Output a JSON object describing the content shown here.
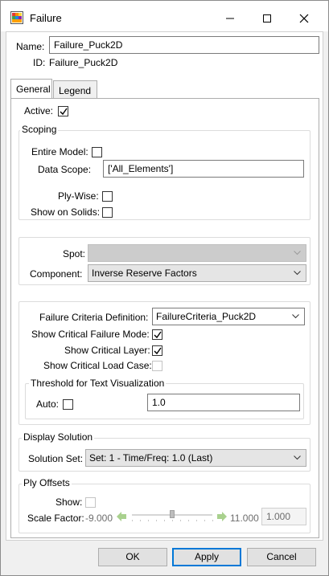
{
  "window": {
    "title": "Failure",
    "icon": "failure-app-icon",
    "minimize_icon": "minimize-icon",
    "maximize_icon": "maximize-icon",
    "close_icon": "close-icon"
  },
  "header": {
    "name_label": "Name:",
    "name_value": "Failure_Puck2D",
    "id_label": "ID:",
    "id_value": "Failure_Puck2D"
  },
  "tabs": [
    {
      "label": "General",
      "active": true
    },
    {
      "label": "Legend",
      "active": false
    }
  ],
  "general": {
    "active_label": "Active:",
    "active_checked": true,
    "scoping": {
      "title": "Scoping",
      "entire_model_label": "Entire Model:",
      "entire_model_checked": false,
      "data_scope_label": "Data Scope:",
      "data_scope_value": "['All_Elements']",
      "ply_wise_label": "Ply-Wise:",
      "ply_wise_checked": false,
      "show_on_solids_label": "Show on Solids:",
      "show_on_solids_checked": false
    },
    "spot_label": "Spot:",
    "spot_value": "",
    "component_label": "Component:",
    "component_value": "Inverse Reserve Factors",
    "failure_criteria_label": "Failure Criteria Definition:",
    "failure_criteria_value": "FailureCriteria_Puck2D",
    "show_critical_failure_mode_label": "Show Critical Failure Mode:",
    "show_critical_failure_mode_checked": true,
    "show_critical_layer_label": "Show Critical Layer:",
    "show_critical_layer_checked": true,
    "show_critical_load_case_label": "Show Critical Load Case:",
    "show_critical_load_case_checked": false,
    "threshold": {
      "title": "Threshold for Text Visualization",
      "auto_label": "Auto:",
      "auto_checked": false,
      "value": "1.0"
    },
    "display_solution": {
      "title": "Display Solution",
      "solution_set_label": "Solution Set:",
      "solution_set_value": "Set: 1 - Time/Freq: 1.0 (Last)"
    },
    "ply_offsets": {
      "title": "Ply Offsets",
      "show_label": "Show:",
      "show_checked": false,
      "scale_factor_label": "Scale Factor:",
      "min": "-9.000",
      "max": "11.000",
      "value": "1.000",
      "slider_fraction": 0.5
    }
  },
  "buttons": {
    "ok": "OK",
    "apply": "Apply",
    "cancel": "Cancel"
  },
  "colors": {
    "accent": "#0078d7",
    "arrow_green": "#5cb85c",
    "checkmark": "#000000"
  }
}
